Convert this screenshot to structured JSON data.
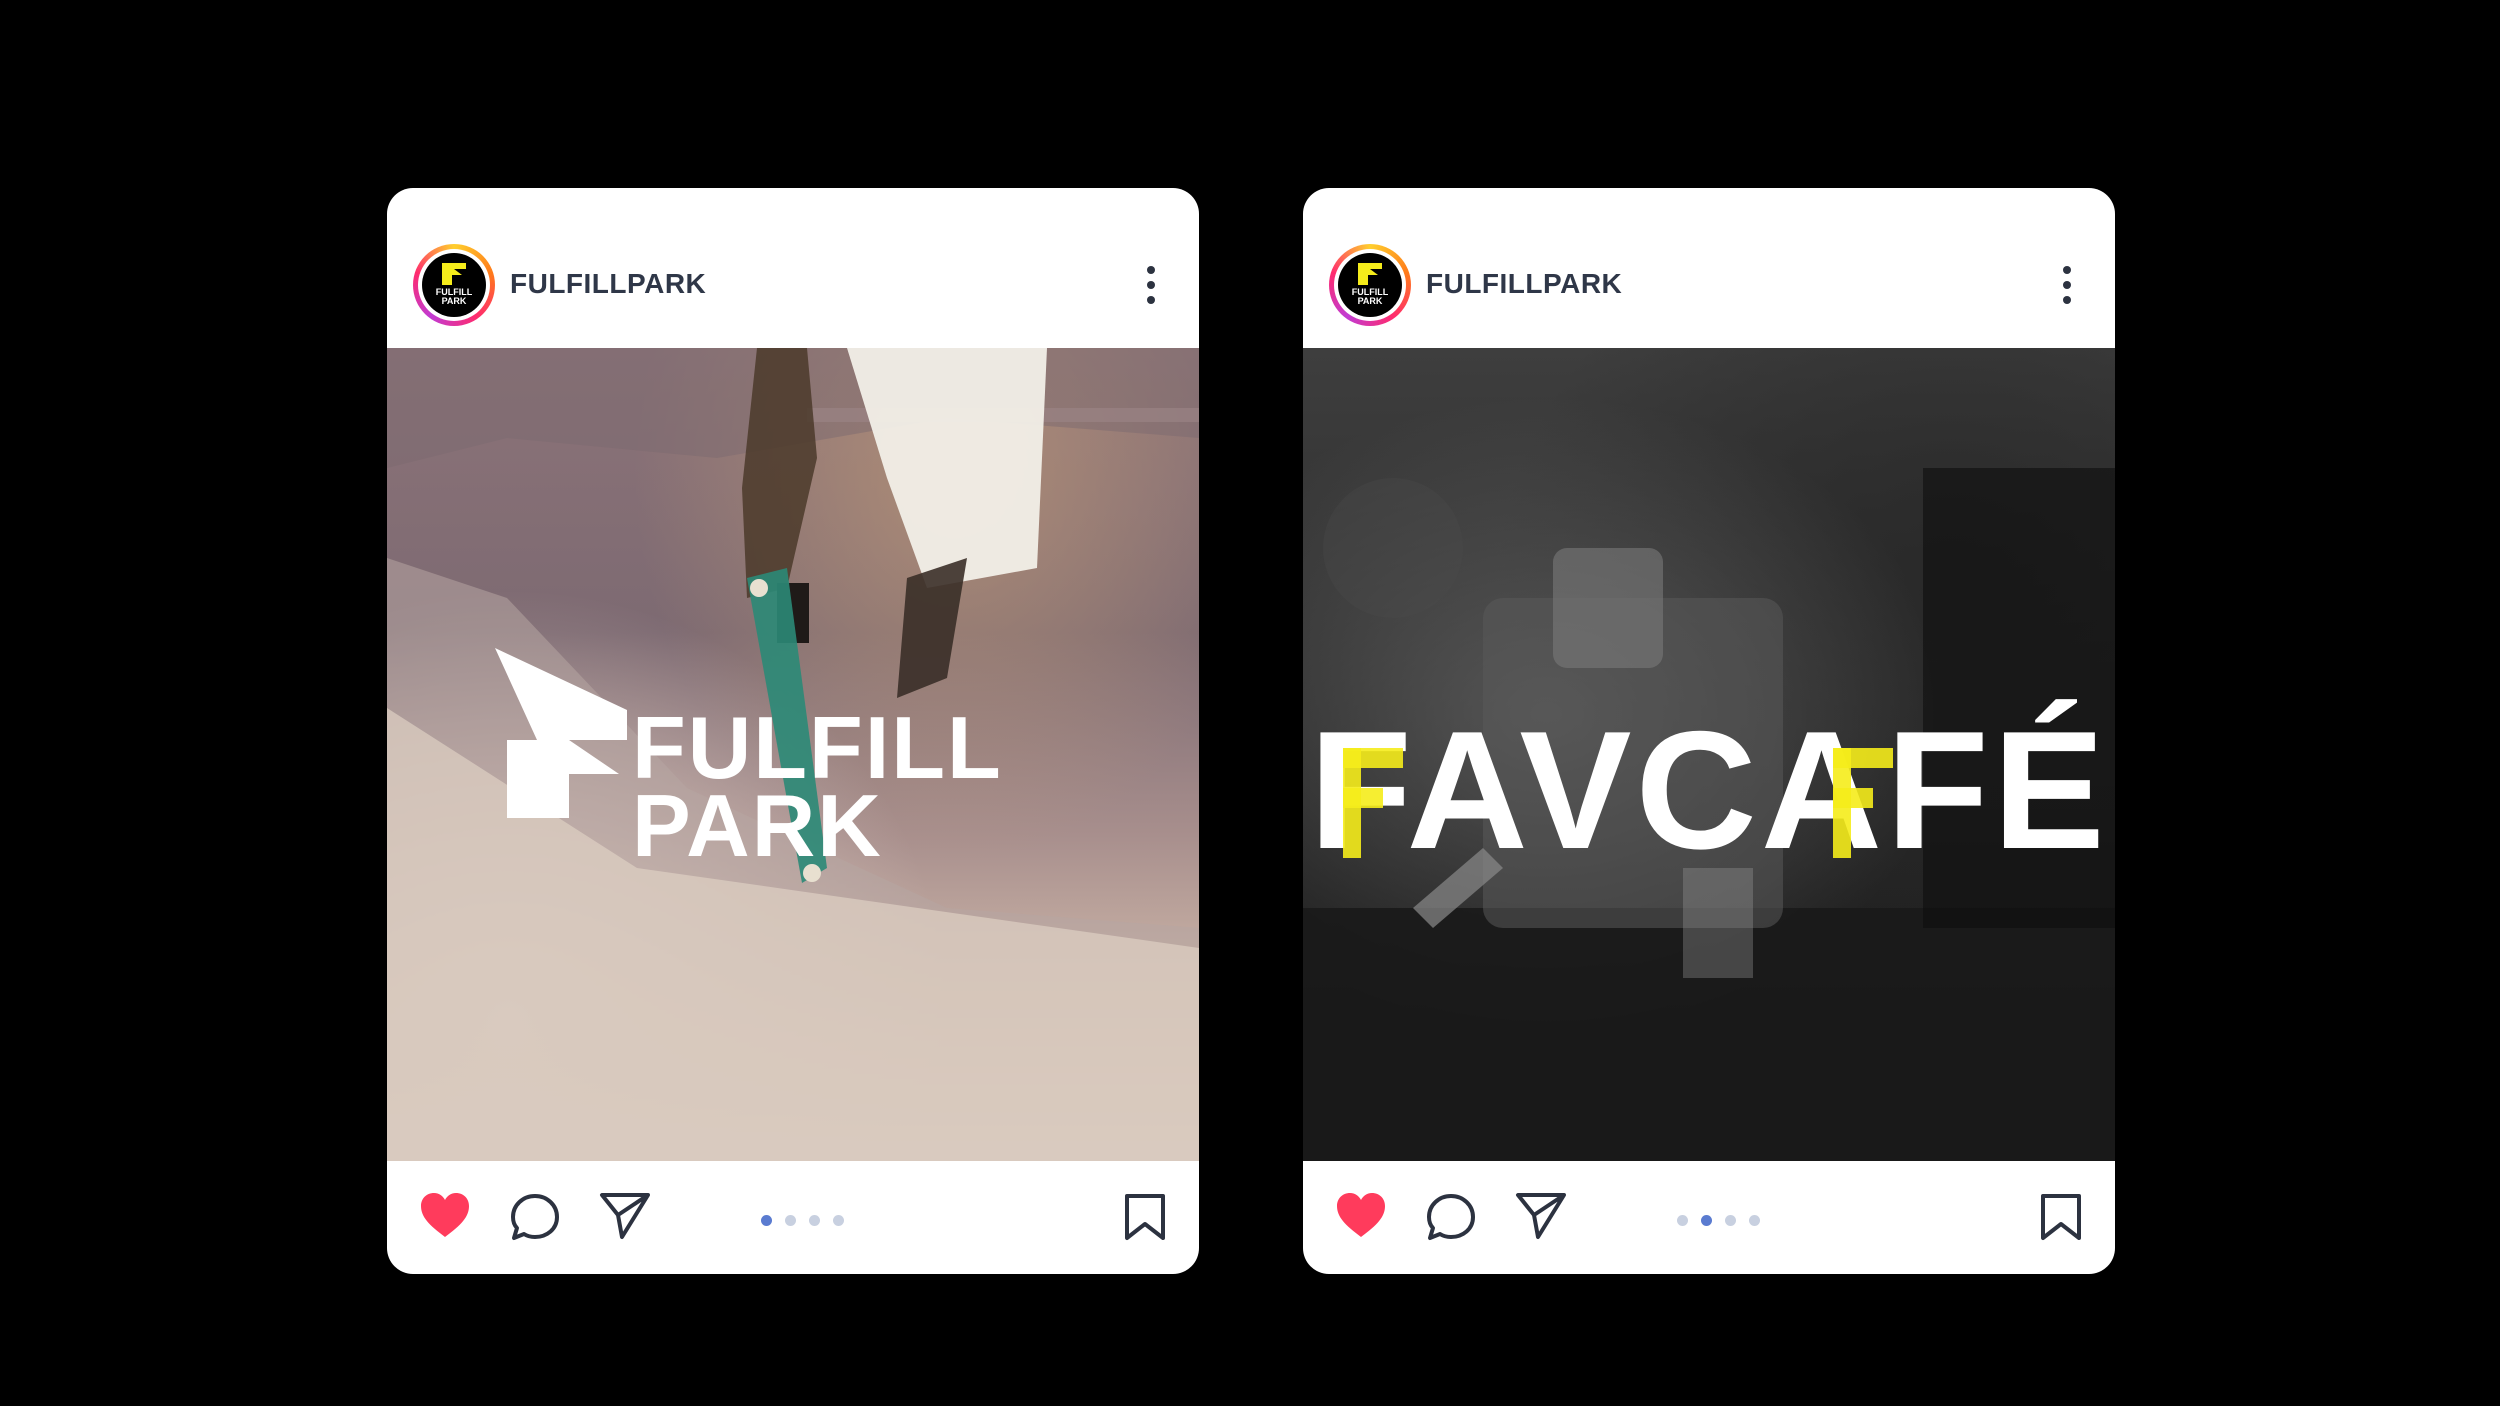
{
  "posts": [
    {
      "account": "FULFILLPARK",
      "avatar_logo_text": [
        "FULFILL",
        "PARK"
      ],
      "image_logo_text": [
        "FULFILL",
        "PARK"
      ],
      "image_subject": "skateboarder at skatepark",
      "carousel": {
        "count": 4,
        "active_index": 0
      },
      "liked": true
    },
    {
      "account": "FULFILLPARK",
      "avatar_logo_text": [
        "FULFILL",
        "PARK"
      ],
      "image_logo_text": "FAVCAFÉ",
      "image_subject": "espresso machine",
      "carousel": {
        "count": 4,
        "active_index": 1
      },
      "liked": true
    }
  ],
  "icons": {
    "like": "heart-icon",
    "comment": "comment-icon",
    "share": "send-icon",
    "save": "bookmark-icon",
    "more": "more-vertical-icon"
  },
  "colors": {
    "background": "#000000",
    "card": "#ffffff",
    "heart": "#ff3b5c",
    "icon_stroke": "#2c3240",
    "brand_yellow": "#f5ec1b",
    "dot_active": "#5a7bd0",
    "dot_inactive": "#c8d0e0"
  }
}
